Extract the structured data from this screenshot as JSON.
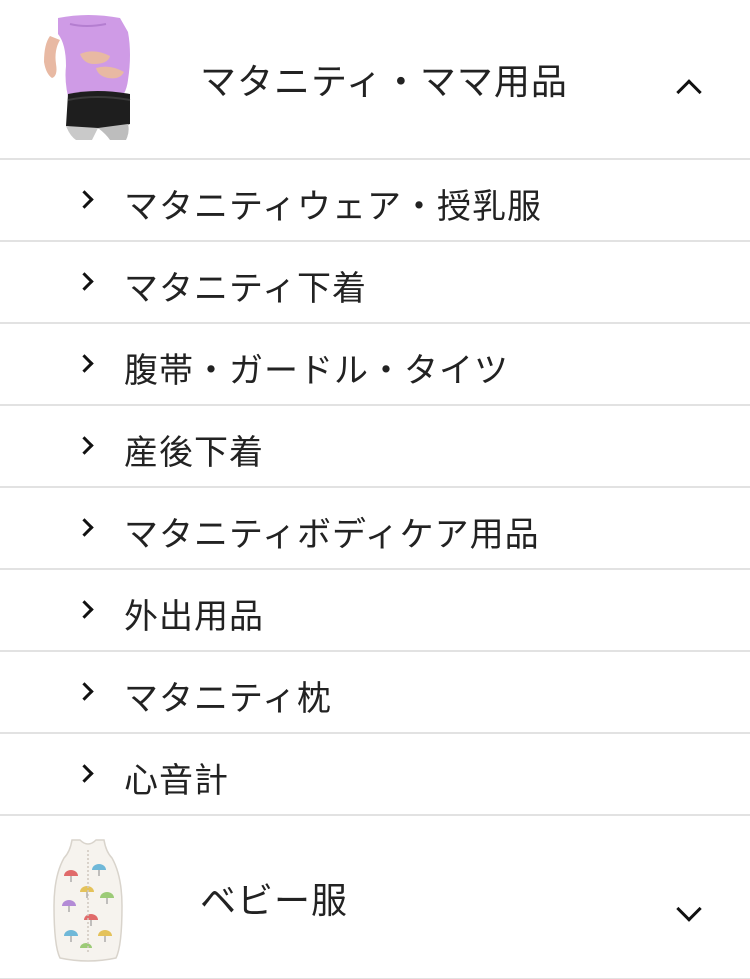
{
  "maternity": {
    "title": "マタニティ・ママ用品",
    "expanded": true,
    "icon": "chevron-up-icon",
    "subcategories": [
      {
        "label": "マタニティウェア・授乳服"
      },
      {
        "label": "マタニティ下着"
      },
      {
        "label": "腹帯・ガードル・タイツ"
      },
      {
        "label": "産後下着"
      },
      {
        "label": "マタニティボディケア用品"
      },
      {
        "label": "外出用品"
      },
      {
        "label": "マタニティ枕"
      },
      {
        "label": "心音計"
      }
    ]
  },
  "baby_clothes": {
    "title": "ベビー服",
    "expanded": false,
    "icon": "chevron-down-icon"
  },
  "colors": {
    "divider": "#e2e2e2",
    "text": "#222222",
    "accent_pink": "#cf9be6"
  }
}
